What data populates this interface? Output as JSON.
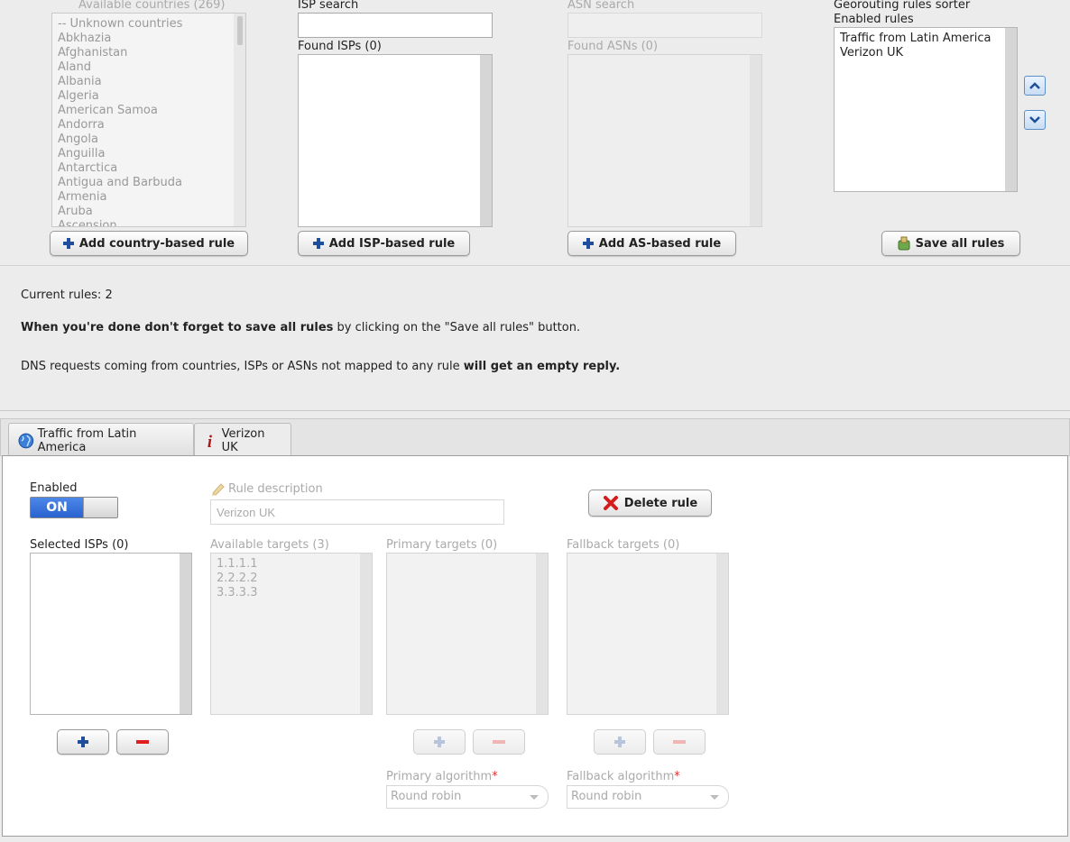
{
  "countries": {
    "label": "Available countries (269)",
    "items": [
      "-- Unknown countries",
      "Abkhazia",
      "Afghanistan",
      "Aland",
      "Albania",
      "Algeria",
      "American Samoa",
      "Andorra",
      "Angola",
      "Anguilla",
      "Antarctica",
      "Antigua and Barbuda",
      "Armenia",
      "Aruba",
      "Ascension"
    ],
    "add_button": "Add country-based rule"
  },
  "isp": {
    "search_label": "ISP search",
    "search_value": "",
    "found_label": "Found ISPs (0)",
    "add_button": "Add ISP-based rule"
  },
  "asn": {
    "search_label": "ASN search",
    "search_value": "",
    "found_label": "Found ASNs (0)",
    "add_button": "Add AS-based rule"
  },
  "sorter": {
    "title": "Georouting rules sorter",
    "enabled_label": "Enabled rules",
    "items": [
      "Traffic from Latin America",
      "Verizon UK"
    ],
    "save_button": "Save all rules"
  },
  "info": {
    "current_rules_label": "Current rules:",
    "current_rules_count": "2",
    "save_reminder_bold": "When you're done don't forget to save all rules",
    "save_reminder_rest": " by clicking on the \"Save all rules\" button.",
    "dns_note_start": "DNS requests coming from countries, ISPs or ASNs not mapped to any rule ",
    "dns_note_bold": "will get an empty reply."
  },
  "tabs": [
    {
      "label": "Traffic from Latin America",
      "icon": "globe-icon"
    },
    {
      "label": "Verizon UK",
      "icon": "info-icon"
    }
  ],
  "rule": {
    "enabled_label": "Enabled",
    "toggle_on": "ON",
    "description_label": "Rule description",
    "description_value": "Verizon UK",
    "delete_button": "Delete rule",
    "selected_isps_label": "Selected ISPs (0)",
    "available_targets_label": "Available targets (3)",
    "available_targets": [
      "1.1.1.1",
      "2.2.2.2",
      "3.3.3.3"
    ],
    "primary_targets_label": "Primary targets (0)",
    "fallback_targets_label": "Fallback targets (0)",
    "primary_algorithm_label": "Primary algorithm",
    "primary_algorithm_value": "Round robin",
    "fallback_algorithm_label": "Fallback algorithm",
    "fallback_algorithm_value": "Round robin",
    "required_mark": "*"
  }
}
